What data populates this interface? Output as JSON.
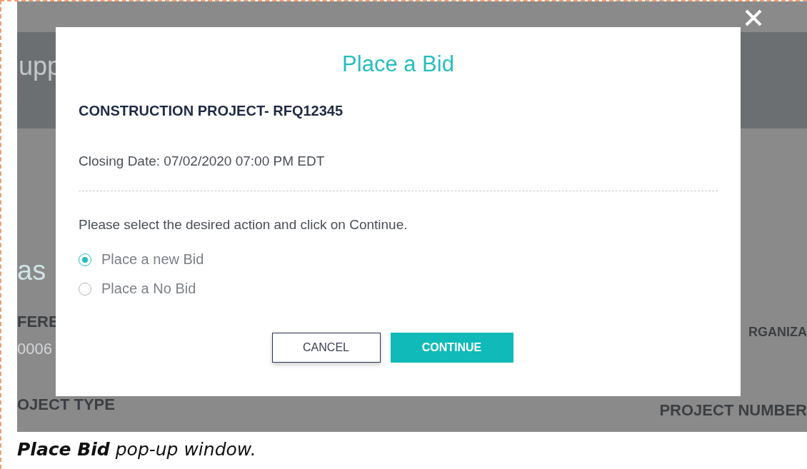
{
  "background_page": {
    "header_fragment": "upp",
    "heading_fragment": "as",
    "fields": [
      {
        "label": "FERE",
        "value": "0006"
      },
      {
        "label": "OJECT TYPE"
      }
    ],
    "right_fields": [
      {
        "label": "RGANIZA"
      },
      {
        "label": "PROJECT NUMBER"
      }
    ]
  },
  "dialog": {
    "title": "Place a Bid",
    "project": "CONSTRUCTION PROJECT- RFQ12345",
    "closing_date": "Closing Date: 07/02/2020 07:00 PM EDT",
    "instruction": "Please select the desired action and click on Continue.",
    "options": [
      {
        "label": "Place a new Bid",
        "selected": true
      },
      {
        "label": "Place a No Bid",
        "selected": false
      }
    ],
    "buttons": [
      {
        "label": "CANCEL",
        "kind": "secondary"
      },
      {
        "label": "CONTINUE",
        "kind": "primary"
      }
    ]
  },
  "caption": "**Place Bid** pop-up window."
}
